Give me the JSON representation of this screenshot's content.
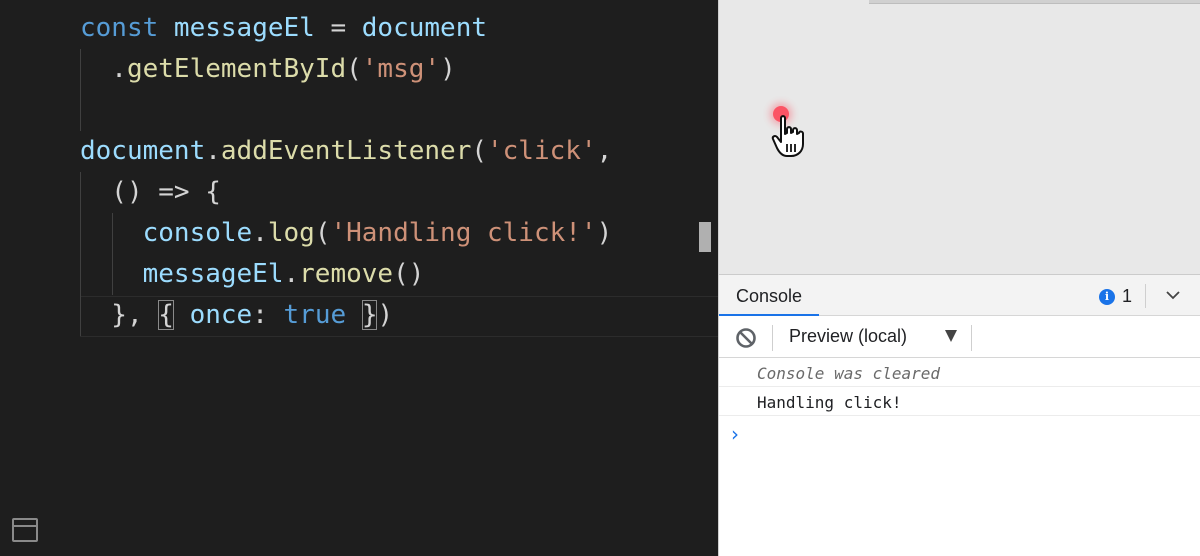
{
  "editor": {
    "lines": [
      {
        "tokens": [
          {
            "t": "const ",
            "c": "kw"
          },
          {
            "t": "messageEl",
            "c": "var"
          },
          {
            "t": " = ",
            "c": "punc"
          },
          {
            "t": "document",
            "c": "var"
          }
        ]
      },
      {
        "tokens": [
          {
            "t": "  .",
            "c": "punc"
          },
          {
            "t": "getElementById",
            "c": "fn"
          },
          {
            "t": "(",
            "c": "punc"
          },
          {
            "t": "'msg'",
            "c": "str"
          },
          {
            "t": ")",
            "c": "punc"
          }
        ]
      },
      {
        "tokens": []
      },
      {
        "tokens": [
          {
            "t": "document",
            "c": "var"
          },
          {
            "t": ".",
            "c": "punc"
          },
          {
            "t": "addEventListener",
            "c": "fn"
          },
          {
            "t": "(",
            "c": "punc"
          },
          {
            "t": "'click'",
            "c": "str"
          },
          {
            "t": ",",
            "c": "punc"
          }
        ]
      },
      {
        "tokens": [
          {
            "t": "  () => {",
            "c": "punc"
          }
        ]
      },
      {
        "tokens": [
          {
            "t": "    console",
            "c": "var"
          },
          {
            "t": ".",
            "c": "punc"
          },
          {
            "t": "log",
            "c": "fn"
          },
          {
            "t": "(",
            "c": "punc"
          },
          {
            "t": "'Handling click!'",
            "c": "str"
          },
          {
            "t": ")",
            "c": "punc"
          }
        ]
      },
      {
        "tokens": [
          {
            "t": "    messageEl",
            "c": "var"
          },
          {
            "t": ".",
            "c": "punc"
          },
          {
            "t": "remove",
            "c": "fn"
          },
          {
            "t": "()",
            "c": "punc"
          }
        ]
      },
      {
        "tokens": [
          {
            "t": "  }, ",
            "c": "punc"
          },
          {
            "t": "{",
            "c": "punc bracket-box"
          },
          {
            "t": " ",
            "c": "punc"
          },
          {
            "t": "once",
            "c": "var"
          },
          {
            "t": ": ",
            "c": "punc"
          },
          {
            "t": "true",
            "c": "kw"
          },
          {
            "t": " ",
            "c": "punc"
          },
          {
            "t": "}",
            "c": "punc bracket-box"
          },
          {
            "t": ")",
            "c": "punc"
          }
        ]
      }
    ]
  },
  "devtools": {
    "tab_label": "Console",
    "info_count": "1",
    "context_label": "Preview (local)",
    "messages": [
      {
        "text": "Console was cleared",
        "kind": "cleared"
      },
      {
        "text": "Handling click!",
        "kind": "log"
      }
    ],
    "prompt_symbol": "›"
  },
  "colors": {
    "accent": "#1a73e8",
    "click_indicator": "#ff3b4f"
  },
  "icons": {
    "clear": "block-icon",
    "info": "info-icon",
    "collapse": "chevron-down-icon",
    "layout": "panel-layout-icon",
    "pointer": "hand-pointer-icon"
  }
}
